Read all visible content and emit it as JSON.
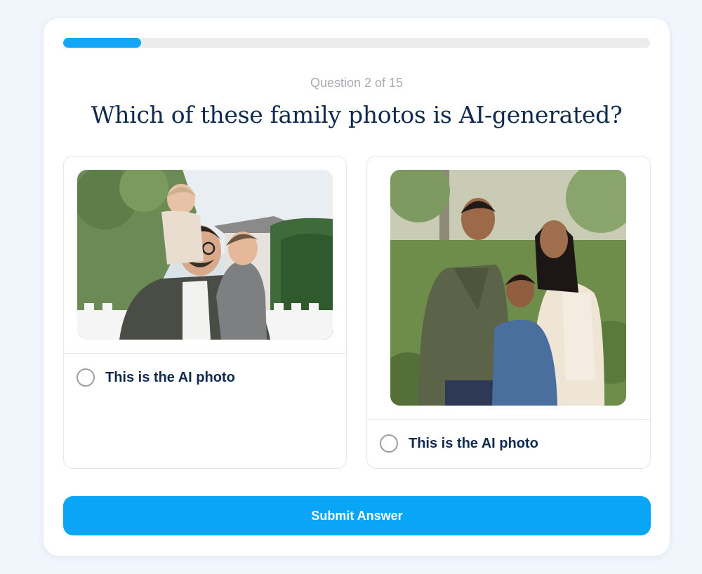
{
  "progress": {
    "current": 2,
    "total": 15,
    "fraction": 0.1333
  },
  "question": {
    "counter_text": "Question 2 of 15",
    "title": "Which of these family photos is AI-generated?"
  },
  "options": [
    {
      "image_icon": "family-photo-dad-two-kids",
      "label": "This is the AI photo",
      "selected": false
    },
    {
      "image_icon": "family-photo-parents-and-son",
      "label": "This is the AI photo",
      "selected": false
    }
  ],
  "submit": {
    "label": "Submit Answer"
  },
  "colors": {
    "accent": "#09a6f7",
    "title": "#0f2a4f",
    "counter": "#a8abb2",
    "track": "#ececec",
    "background": "#f1f6fd"
  }
}
